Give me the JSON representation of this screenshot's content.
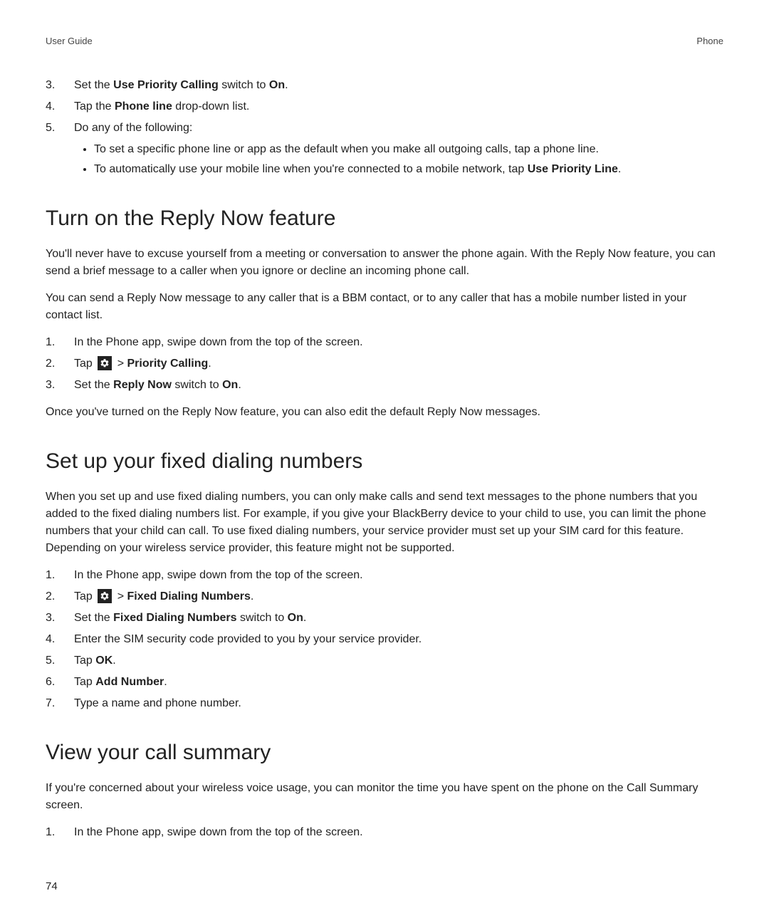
{
  "header": {
    "left": "User Guide",
    "right": "Phone"
  },
  "intro_steps": [
    {
      "num": "3.",
      "parts": [
        "Set the ",
        {
          "b": "Use Priority Calling"
        },
        " switch to ",
        {
          "b": "On"
        },
        "."
      ]
    },
    {
      "num": "4.",
      "parts": [
        "Tap the ",
        {
          "b": "Phone line"
        },
        " drop-down list."
      ]
    },
    {
      "num": "5.",
      "parts": [
        "Do any of the following:"
      ],
      "bullets": [
        "To set a specific phone line or app as the default when you make all outgoing calls, tap a phone line.",
        [
          "To automatically use your mobile line when you're connected to a mobile network, tap ",
          {
            "b": "Use Priority Line"
          },
          "."
        ]
      ]
    }
  ],
  "sections": [
    {
      "id": "reply-now",
      "title": "Turn on the Reply Now feature",
      "paras": [
        "You'll never have to excuse yourself from a meeting or conversation to answer the phone again. With the Reply Now feature, you can send a brief message to a caller when you ignore or decline an incoming phone call.",
        "You can send a Reply Now message to any caller that is a BBM contact, or to any caller that has a mobile number listed in your contact list."
      ],
      "steps": [
        {
          "num": "1.",
          "parts": [
            "In the Phone app, swipe down from the top of the screen."
          ]
        },
        {
          "num": "2.",
          "parts": [
            "Tap ",
            {
              "icon": "gear"
            },
            " > ",
            {
              "b": "Priority Calling"
            },
            "."
          ]
        },
        {
          "num": "3.",
          "parts": [
            "Set the ",
            {
              "b": "Reply Now"
            },
            " switch to ",
            {
              "b": "On"
            },
            "."
          ]
        }
      ],
      "after": [
        "Once you've turned on the Reply Now feature, you can also edit the default Reply Now messages."
      ]
    },
    {
      "id": "fixed-dialing",
      "title": "Set up your fixed dialing numbers",
      "paras": [
        "When you set up and use fixed dialing numbers, you can only make calls and send text messages to the phone numbers that you added to the fixed dialing numbers list. For example, if you give your BlackBerry device to your child to use, you can limit the phone numbers that your child can call. To use fixed dialing numbers, your service provider must set up your SIM card for this feature. Depending on your wireless service provider, this feature might not be supported."
      ],
      "steps": [
        {
          "num": "1.",
          "parts": [
            "In the Phone app, swipe down from the top of the screen."
          ]
        },
        {
          "num": "2.",
          "parts": [
            "Tap ",
            {
              "icon": "gear"
            },
            " > ",
            {
              "b": "Fixed Dialing Numbers"
            },
            "."
          ]
        },
        {
          "num": "3.",
          "parts": [
            "Set the ",
            {
              "b": "Fixed Dialing Numbers"
            },
            " switch to ",
            {
              "b": "On"
            },
            "."
          ]
        },
        {
          "num": "4.",
          "parts": [
            "Enter the SIM security code provided to you by your service provider."
          ]
        },
        {
          "num": "5.",
          "parts": [
            "Tap ",
            {
              "b": "OK"
            },
            "."
          ]
        },
        {
          "num": "6.",
          "parts": [
            "Tap ",
            {
              "b": "Add Number"
            },
            "."
          ]
        },
        {
          "num": "7.",
          "parts": [
            "Type a name and phone number."
          ]
        }
      ]
    },
    {
      "id": "call-summary",
      "title": "View your call summary",
      "paras": [
        "If you're concerned about your wireless voice usage, you can monitor the time you have spent on the phone on the Call Summary screen."
      ],
      "steps": [
        {
          "num": "1.",
          "parts": [
            "In the Phone app, swipe down from the top of the screen."
          ]
        }
      ]
    }
  ],
  "page_number": "74"
}
